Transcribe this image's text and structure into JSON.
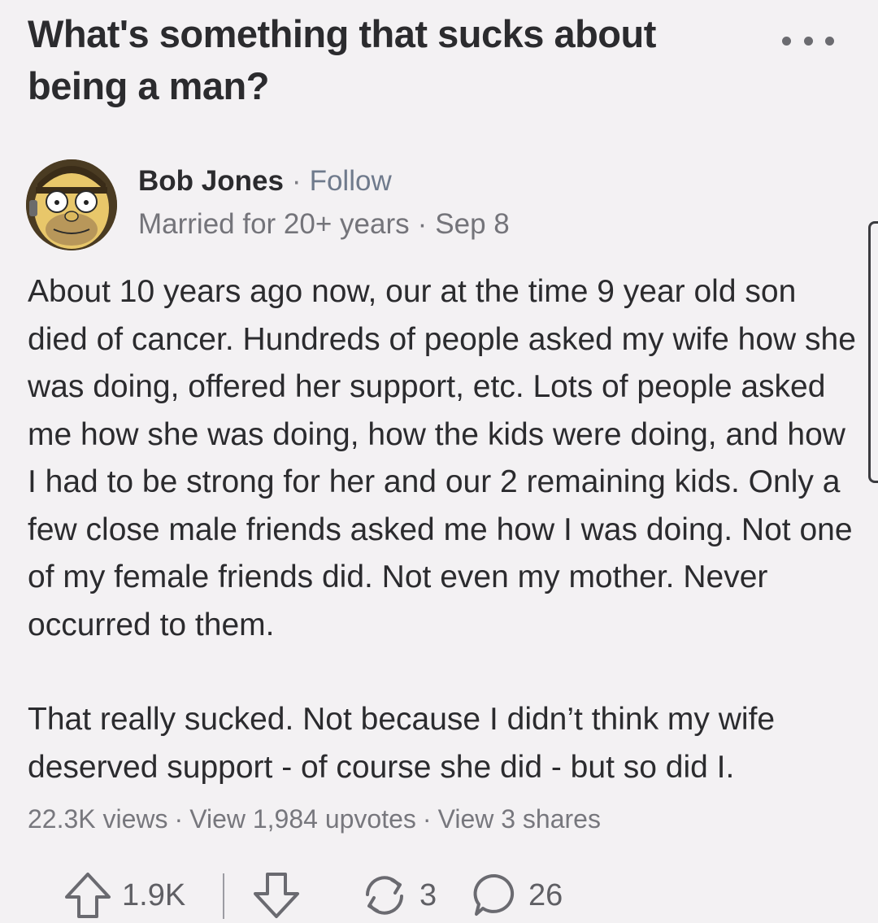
{
  "question": {
    "title": "What's something that sucks about being a man?",
    "more_icon": "more-horizontal-icon"
  },
  "author": {
    "name": "Bob Jones",
    "separator": "·",
    "follow_label": "Follow",
    "credential": "Married for 20+ years",
    "date": "Sep 8",
    "avatar_icon": "avatar-cartoon-face"
  },
  "answer": {
    "paragraphs": [
      "About 10 years ago now, our at the time 9 year old son died of cancer. Hundreds of people asked my wife how she was doing, offered her support, etc. Lots of people asked me how she was doing, how the kids were doing, and how I had to be strong for her and our 2 remaining kids. Only a few close male friends asked me how I was doing. Not one of my female friends did. Not even my mother. Never occurred to them.",
      "That really sucked. Not because I didn’t think my wife deserved support - of course she did - but so did I."
    ]
  },
  "stats": {
    "views": "22.3K views",
    "upvotes": "View 1,984 upvotes",
    "shares": "View 3 shares",
    "separator": "·"
  },
  "actions": {
    "upvote_icon": "upvote-arrow-icon",
    "upvote_count": "1.9K",
    "downvote_icon": "downvote-arrow-icon",
    "share_icon": "reshare-icon",
    "share_count": "3",
    "comment_icon": "comment-bubble-icon",
    "comment_count": "26"
  },
  "colors": {
    "background": "#f3f1f3",
    "text": "#2b2b2e",
    "muted": "#74747a",
    "follow": "#6f7a8c"
  }
}
